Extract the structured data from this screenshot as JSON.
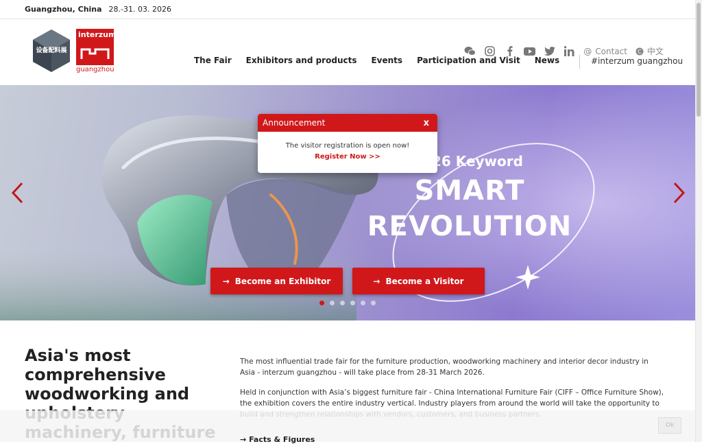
{
  "topbar": {
    "city": "Guangzhou, China",
    "dates": "28.-31. 03. 2026"
  },
  "logo": {
    "brand": "interzum",
    "sub": "guangzhou",
    "hex_text": "设备配料展"
  },
  "social": {
    "contact": "Contact",
    "language": "中文"
  },
  "nav": [
    "The Fair",
    "Exhibitors and products",
    "Events",
    "Participation and Visit",
    "News"
  ],
  "hashtag": "#interzum guangzhou",
  "hero": {
    "keyword": "26 Keyword",
    "headline1": "SMART",
    "headline2": "REVOLUTION",
    "btn_exhibitor": "Become an Exhibitor",
    "btn_visitor": "Become a Visitor",
    "slides": 6,
    "active_slide": 1
  },
  "announcement": {
    "title": "Announcement",
    "close": "x",
    "message": "The visitor registration is open now!",
    "link": "Register Now >>"
  },
  "main": {
    "heading": "Asia's most comprehensive woodworking and upholstery machinery, furniture",
    "para1": "The most influential trade fair for the furniture production, woodworking machinery and interior decor industry in Asia - interzum guangzhou - will take place from 28-31 March 2026.",
    "para2": "Held in conjunction with Asia’s biggest furniture fair - China International Furniture Fair (CIFF – Office Furniture Show), the exhibition covers the entire industry vertical. Industry players from around the world will take the opportunity to build and strengthen relationships with vendors, customers, and business partners.",
    "more": "Facts & Figures"
  },
  "cookie": {
    "ok": "Ok"
  },
  "colors": {
    "accent": "#d0181b",
    "hero_purple": "#8d7ad0"
  }
}
